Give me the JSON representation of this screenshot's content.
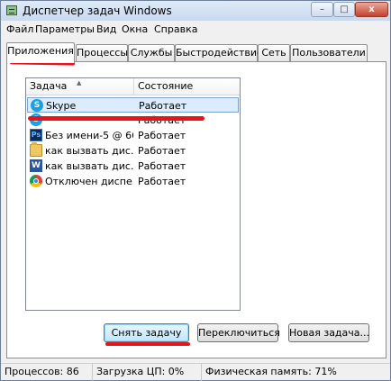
{
  "window": {
    "title": "Диспетчер задач Windows"
  },
  "titlebar_buttons": {
    "minimize": "–",
    "maximize": "□",
    "close": "x"
  },
  "menu": [
    {
      "label": "Файл"
    },
    {
      "label": "Параметры"
    },
    {
      "label": "Вид"
    },
    {
      "label": "Окна"
    },
    {
      "label": "Справка"
    }
  ],
  "tabs": [
    {
      "label": "Приложения",
      "active": true
    },
    {
      "label": "Процессы"
    },
    {
      "label": "Службы"
    },
    {
      "label": "Быстродействие"
    },
    {
      "label": "Сеть"
    },
    {
      "label": "Пользователи"
    }
  ],
  "tasks_table": {
    "columns": [
      "Задача",
      "Состояние"
    ],
    "rows": [
      {
        "name": "Skype",
        "status": "Работает",
        "icon": "skype-icon",
        "selected": true
      },
      {
        "name": "",
        "status": "Работает",
        "icon": "skype-icon"
      },
      {
        "name": "Без имени-5 @ 66...",
        "status": "Работает",
        "icon": "photoshop-icon"
      },
      {
        "name": "как вызвать дис...",
        "status": "Работает",
        "icon": "folder-icon"
      },
      {
        "name": "как вызвать дис...",
        "status": "Работает",
        "icon": "word-icon"
      },
      {
        "name": "Отключен диспе...",
        "status": "Работает",
        "icon": "chrome-icon"
      }
    ]
  },
  "buttons": {
    "end_task": "Снять задачу",
    "switch_to": "Переключиться",
    "new_task": "Новая задача..."
  },
  "statusbar": {
    "processes": "Процессов: 86",
    "cpu": "Загрузка ЦП: 0%",
    "memory": "Физическая память: 71%"
  },
  "colors": {
    "annotation_marks": "#e8141b",
    "selection": "#dcecfc"
  }
}
